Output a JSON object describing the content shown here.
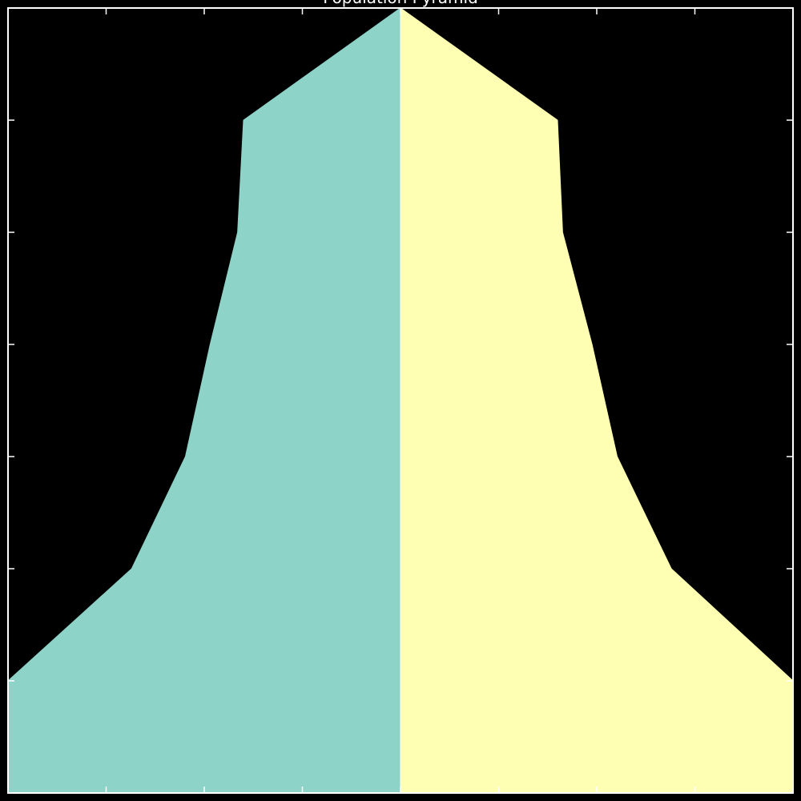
{
  "chart_data": {
    "type": "area",
    "title": "Population Pyramid",
    "xlabel": "",
    "ylabel": "",
    "x_axis_range": [
      -1,
      1
    ],
    "y_axis_range": [
      0,
      7
    ],
    "grid": false,
    "legend": "none",
    "age_levels": [
      0,
      1,
      2,
      3,
      4,
      5,
      6,
      7
    ],
    "series": [
      {
        "name": "",
        "side": "left",
        "color": "#8dd3c7",
        "values": [
          1.0,
          1.0,
          0.685,
          0.548,
          0.485,
          0.415,
          0.4,
          0.0
        ]
      },
      {
        "name": "",
        "side": "right",
        "color": "#ffffb3",
        "values": [
          1.0,
          1.0,
          0.69,
          0.552,
          0.488,
          0.413,
          0.4,
          0.0
        ]
      }
    ],
    "colors": {
      "background": "#000000",
      "axes": "#ffffff",
      "title": "#ffffff"
    }
  }
}
